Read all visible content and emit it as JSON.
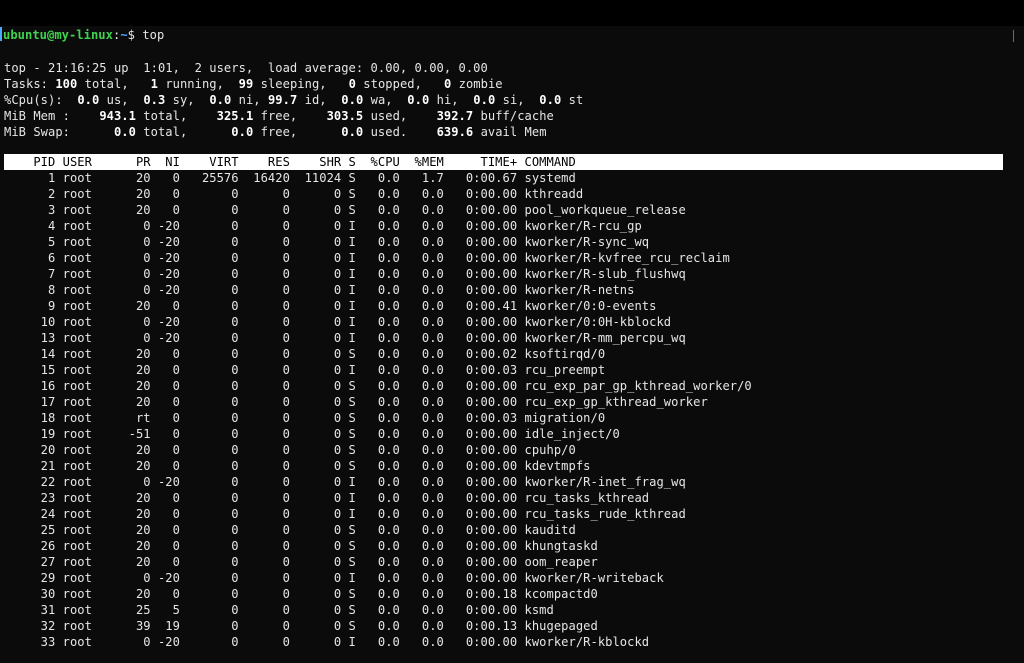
{
  "prompt": {
    "user_host": "ubuntu@my-linux",
    "colon": ":",
    "path": "~",
    "symbol": "$ ",
    "command": "top"
  },
  "summary": {
    "l1_a": "top - 21:16:25 up  1:01,  2 users,  load average: 0.00, 0.00, 0.00",
    "l2_a": "Tasks: ",
    "l2_total": "100",
    "l2_b": " total,   ",
    "l2_running": "1",
    "l2_c": " running,  ",
    "l2_sleeping": "99",
    "l2_d": " sleeping,   ",
    "l2_stopped": "0",
    "l2_e": " stopped,   ",
    "l2_zombie": "0",
    "l2_f": " zombie",
    "l3_a": "%Cpu(s):  ",
    "l3_us": "0.0",
    "l3_b": " us,  ",
    "l3_sy": "0.3",
    "l3_c": " sy,  ",
    "l3_ni": "0.0",
    "l3_d": " ni, ",
    "l3_id": "99.7",
    "l3_e": " id,  ",
    "l3_wa": "0.0",
    "l3_f": " wa,  ",
    "l3_hi": "0.0",
    "l3_g": " hi,  ",
    "l3_si": "0.0",
    "l3_h": " si,  ",
    "l3_st": "0.0",
    "l3_i": " st",
    "l4_a": "MiB Mem :    ",
    "l4_total": "943.1",
    "l4_b": " total,    ",
    "l4_free": "325.1",
    "l4_c": " free,    ",
    "l4_used": "303.5",
    "l4_d": " used,    ",
    "l4_cache": "392.7",
    "l4_e": " buff/cache",
    "l5_a": "MiB Swap:      ",
    "l5_total": "0.0",
    "l5_b": " total,      ",
    "l5_free": "0.0",
    "l5_c": " free,      ",
    "l5_used": "0.0",
    "l5_d": " used.    ",
    "l5_avail": "639.6",
    "l5_e": " avail Mem"
  },
  "table": {
    "header": "    PID USER      PR  NI    VIRT    RES    SHR S  %CPU  %MEM     TIME+ COMMAND",
    "rows": [
      [
        "1",
        "root",
        "20",
        "0",
        "25576",
        "16420",
        "11024",
        "S",
        "0.0",
        "1.7",
        "0:00.67",
        "systemd"
      ],
      [
        "2",
        "root",
        "20",
        "0",
        "0",
        "0",
        "0",
        "S",
        "0.0",
        "0.0",
        "0:00.00",
        "kthreadd"
      ],
      [
        "3",
        "root",
        "20",
        "0",
        "0",
        "0",
        "0",
        "S",
        "0.0",
        "0.0",
        "0:00.00",
        "pool_workqueue_release"
      ],
      [
        "4",
        "root",
        "0",
        "-20",
        "0",
        "0",
        "0",
        "I",
        "0.0",
        "0.0",
        "0:00.00",
        "kworker/R-rcu_gp"
      ],
      [
        "5",
        "root",
        "0",
        "-20",
        "0",
        "0",
        "0",
        "I",
        "0.0",
        "0.0",
        "0:00.00",
        "kworker/R-sync_wq"
      ],
      [
        "6",
        "root",
        "0",
        "-20",
        "0",
        "0",
        "0",
        "I",
        "0.0",
        "0.0",
        "0:00.00",
        "kworker/R-kvfree_rcu_reclaim"
      ],
      [
        "7",
        "root",
        "0",
        "-20",
        "0",
        "0",
        "0",
        "I",
        "0.0",
        "0.0",
        "0:00.00",
        "kworker/R-slub_flushwq"
      ],
      [
        "8",
        "root",
        "0",
        "-20",
        "0",
        "0",
        "0",
        "I",
        "0.0",
        "0.0",
        "0:00.00",
        "kworker/R-netns"
      ],
      [
        "9",
        "root",
        "20",
        "0",
        "0",
        "0",
        "0",
        "I",
        "0.0",
        "0.0",
        "0:00.41",
        "kworker/0:0-events"
      ],
      [
        "10",
        "root",
        "0",
        "-20",
        "0",
        "0",
        "0",
        "I",
        "0.0",
        "0.0",
        "0:00.00",
        "kworker/0:0H-kblockd"
      ],
      [
        "13",
        "root",
        "0",
        "-20",
        "0",
        "0",
        "0",
        "I",
        "0.0",
        "0.0",
        "0:00.00",
        "kworker/R-mm_percpu_wq"
      ],
      [
        "14",
        "root",
        "20",
        "0",
        "0",
        "0",
        "0",
        "S",
        "0.0",
        "0.0",
        "0:00.02",
        "ksoftirqd/0"
      ],
      [
        "15",
        "root",
        "20",
        "0",
        "0",
        "0",
        "0",
        "I",
        "0.0",
        "0.0",
        "0:00.03",
        "rcu_preempt"
      ],
      [
        "16",
        "root",
        "20",
        "0",
        "0",
        "0",
        "0",
        "S",
        "0.0",
        "0.0",
        "0:00.00",
        "rcu_exp_par_gp_kthread_worker/0"
      ],
      [
        "17",
        "root",
        "20",
        "0",
        "0",
        "0",
        "0",
        "S",
        "0.0",
        "0.0",
        "0:00.00",
        "rcu_exp_gp_kthread_worker"
      ],
      [
        "18",
        "root",
        "rt",
        "0",
        "0",
        "0",
        "0",
        "S",
        "0.0",
        "0.0",
        "0:00.03",
        "migration/0"
      ],
      [
        "19",
        "root",
        "-51",
        "0",
        "0",
        "0",
        "0",
        "S",
        "0.0",
        "0.0",
        "0:00.00",
        "idle_inject/0"
      ],
      [
        "20",
        "root",
        "20",
        "0",
        "0",
        "0",
        "0",
        "S",
        "0.0",
        "0.0",
        "0:00.00",
        "cpuhp/0"
      ],
      [
        "21",
        "root",
        "20",
        "0",
        "0",
        "0",
        "0",
        "S",
        "0.0",
        "0.0",
        "0:00.00",
        "kdevtmpfs"
      ],
      [
        "22",
        "root",
        "0",
        "-20",
        "0",
        "0",
        "0",
        "I",
        "0.0",
        "0.0",
        "0:00.00",
        "kworker/R-inet_frag_wq"
      ],
      [
        "23",
        "root",
        "20",
        "0",
        "0",
        "0",
        "0",
        "I",
        "0.0",
        "0.0",
        "0:00.00",
        "rcu_tasks_kthread"
      ],
      [
        "24",
        "root",
        "20",
        "0",
        "0",
        "0",
        "0",
        "I",
        "0.0",
        "0.0",
        "0:00.00",
        "rcu_tasks_rude_kthread"
      ],
      [
        "25",
        "root",
        "20",
        "0",
        "0",
        "0",
        "0",
        "S",
        "0.0",
        "0.0",
        "0:00.00",
        "kauditd"
      ],
      [
        "26",
        "root",
        "20",
        "0",
        "0",
        "0",
        "0",
        "S",
        "0.0",
        "0.0",
        "0:00.00",
        "khungtaskd"
      ],
      [
        "27",
        "root",
        "20",
        "0",
        "0",
        "0",
        "0",
        "S",
        "0.0",
        "0.0",
        "0:00.00",
        "oom_reaper"
      ],
      [
        "29",
        "root",
        "0",
        "-20",
        "0",
        "0",
        "0",
        "I",
        "0.0",
        "0.0",
        "0:00.00",
        "kworker/R-writeback"
      ],
      [
        "30",
        "root",
        "20",
        "0",
        "0",
        "0",
        "0",
        "S",
        "0.0",
        "0.0",
        "0:00.18",
        "kcompactd0"
      ],
      [
        "31",
        "root",
        "25",
        "5",
        "0",
        "0",
        "0",
        "S",
        "0.0",
        "0.0",
        "0:00.00",
        "ksmd"
      ],
      [
        "32",
        "root",
        "39",
        "19",
        "0",
        "0",
        "0",
        "S",
        "0.0",
        "0.0",
        "0:00.13",
        "khugepaged"
      ],
      [
        "33",
        "root",
        "0",
        "-20",
        "0",
        "0",
        "0",
        "I",
        "0.0",
        "0.0",
        "0:00.00",
        "kworker/R-kblockd"
      ]
    ]
  },
  "colors": {
    "prompt_user": "#3fd34f",
    "prompt_path": "#4aa8ff",
    "header_bg": "#ffffff",
    "text": "#e6e6e6",
    "background": "#0b0b0b"
  }
}
